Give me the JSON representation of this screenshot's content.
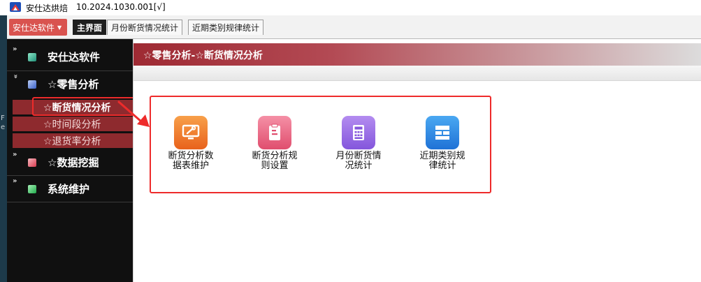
{
  "titlebar": {
    "title": "安仕达烘焙",
    "version": "10.2024.1030.001[√]"
  },
  "left_edge": {
    "frag1": "F",
    "frag2": "e"
  },
  "menu": {
    "label": "安仕达软件"
  },
  "tabs": [
    {
      "label": "主界面",
      "active": true
    },
    {
      "label": "月份断货情况统计",
      "active": false
    },
    {
      "label": "近期类别规律统计",
      "active": false
    }
  ],
  "sidebar": {
    "groups": [
      {
        "label": "安仕达软件",
        "color": "#3fb59c"
      },
      {
        "label": "☆零售分析",
        "color": "#6b8fe0"
      },
      {
        "label": "☆数据挖掘",
        "color": "#e86c7a"
      },
      {
        "label": "系统维护",
        "color": "#3cc96a"
      }
    ],
    "subitems": [
      {
        "label": "☆断货情况分析",
        "selected": true
      },
      {
        "label": "☆时间段分析",
        "selected": false
      },
      {
        "label": "☆退货率分析",
        "selected": false
      }
    ]
  },
  "main": {
    "header": "☆零售分析-☆断货情况分析",
    "tiles": [
      {
        "label1": "断货分析数",
        "label2": "据表维护",
        "icon": "monitor-wrench-icon",
        "color": "#f07a2a"
      },
      {
        "label1": "断货分析规",
        "label2": "则设置",
        "icon": "clipboard-icon",
        "color": "#e8607a"
      },
      {
        "label1": "月份断货情",
        "label2": "况统计",
        "icon": "calculator-icon",
        "color": "#9a6fe0"
      },
      {
        "label1": "近期类别规",
        "label2": "律统计",
        "icon": "grid-layout-icon",
        "color": "#2f8fe0"
      }
    ]
  },
  "colors": {
    "highlight": "#ee2b2b",
    "sidebar_bg": "#101010",
    "submenu_bg": "#8e2a2e",
    "header_red": "#9e2a33"
  }
}
